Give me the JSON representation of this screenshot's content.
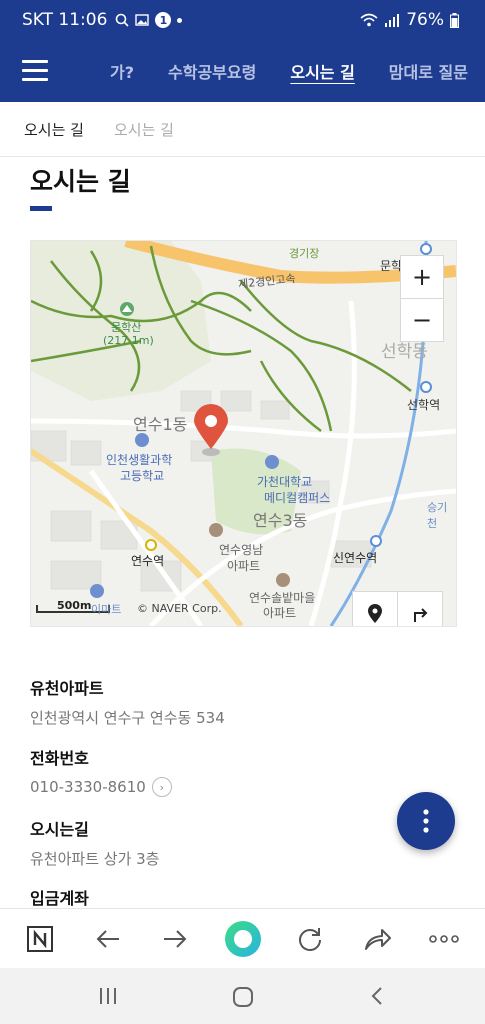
{
  "status": {
    "carrier_time": "SKT 11:06",
    "notif_count": "1",
    "battery": "76%"
  },
  "nav": {
    "tabs": [
      "가?",
      "수학공부요령",
      "오시는 길",
      "맘대로 질문"
    ],
    "active": "오시는 길"
  },
  "subnav": {
    "items": [
      "오시는 길",
      "오시는 길"
    ]
  },
  "page": {
    "title": "오시는 길"
  },
  "map": {
    "labels": {
      "highway": "제2경인고속",
      "mountain": "문학산",
      "mountain_height": "(217.1m)",
      "district1": "연수1동",
      "district3": "연수3동",
      "school1": "인천생활과학",
      "school2": "고등학교",
      "campus1": "가천대학교",
      "campus2": "메디컬캠퍼스",
      "yeonsu_station": "연수역",
      "sinyeonsu_station": "신연수역",
      "seonhak_station": "선학역",
      "seonhak_dong": "선학동",
      "munhak": "문학",
      "yeong1": "연수영남",
      "yeong2": "아파트",
      "sol1": "연수솔밭마을",
      "sol2": "아파트",
      "stadium": "경기장",
      "seunggi": "승기천",
      "mart": "이마트",
      "scale": "500m",
      "copyright": "© NAVER Corp."
    },
    "zoom_in": "+",
    "zoom_out": "−"
  },
  "info": {
    "place_label": "유천아파트",
    "address": "인천광역시 연수구 연수동 534",
    "phone_label": "전화번호",
    "phone": "010-3330-8610",
    "directions_label": "오시는길",
    "directions": "유천아파트 상가 3층",
    "account_label": "입금계좌"
  },
  "colors": {
    "brand": "#1d3b8f",
    "pin": "#e0533c",
    "park": "#6b9a3a",
    "road": "#f7c36b"
  }
}
